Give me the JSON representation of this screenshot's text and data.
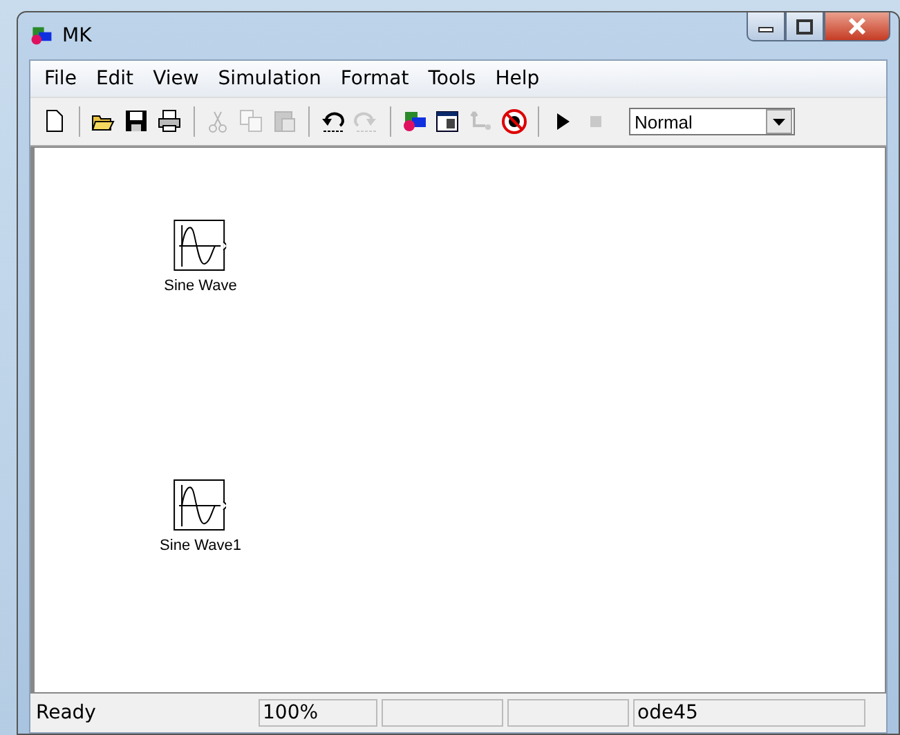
{
  "window": {
    "title": "MK"
  },
  "menu": [
    "File",
    "Edit",
    "View",
    "Simulation",
    "Format",
    "Tools",
    "Help"
  ],
  "toolbar": [
    {
      "kind": "new",
      "disabled": false
    },
    {
      "kind": "sep"
    },
    {
      "kind": "open",
      "disabled": false
    },
    {
      "kind": "save",
      "disabled": false
    },
    {
      "kind": "print",
      "disabled": false
    },
    {
      "kind": "sep"
    },
    {
      "kind": "cut",
      "disabled": true
    },
    {
      "kind": "copy",
      "disabled": true
    },
    {
      "kind": "paste",
      "disabled": true
    },
    {
      "kind": "sep"
    },
    {
      "kind": "undo",
      "disabled": false
    },
    {
      "kind": "redo",
      "disabled": true
    },
    {
      "kind": "sep"
    },
    {
      "kind": "library",
      "disabled": false
    },
    {
      "kind": "explorer",
      "disabled": false
    },
    {
      "kind": "update",
      "disabled": true
    },
    {
      "kind": "debug",
      "disabled": false
    },
    {
      "kind": "sep"
    },
    {
      "kind": "play",
      "disabled": false
    },
    {
      "kind": "stop",
      "disabled": true
    }
  ],
  "sim_mode": {
    "value": "Normal"
  },
  "blocks": [
    {
      "label": "Sine Wave"
    },
    {
      "label": "Sine Wave1"
    }
  ],
  "status_bar": {
    "message": "Ready",
    "zoom": "100%",
    "solver": "ode45"
  }
}
